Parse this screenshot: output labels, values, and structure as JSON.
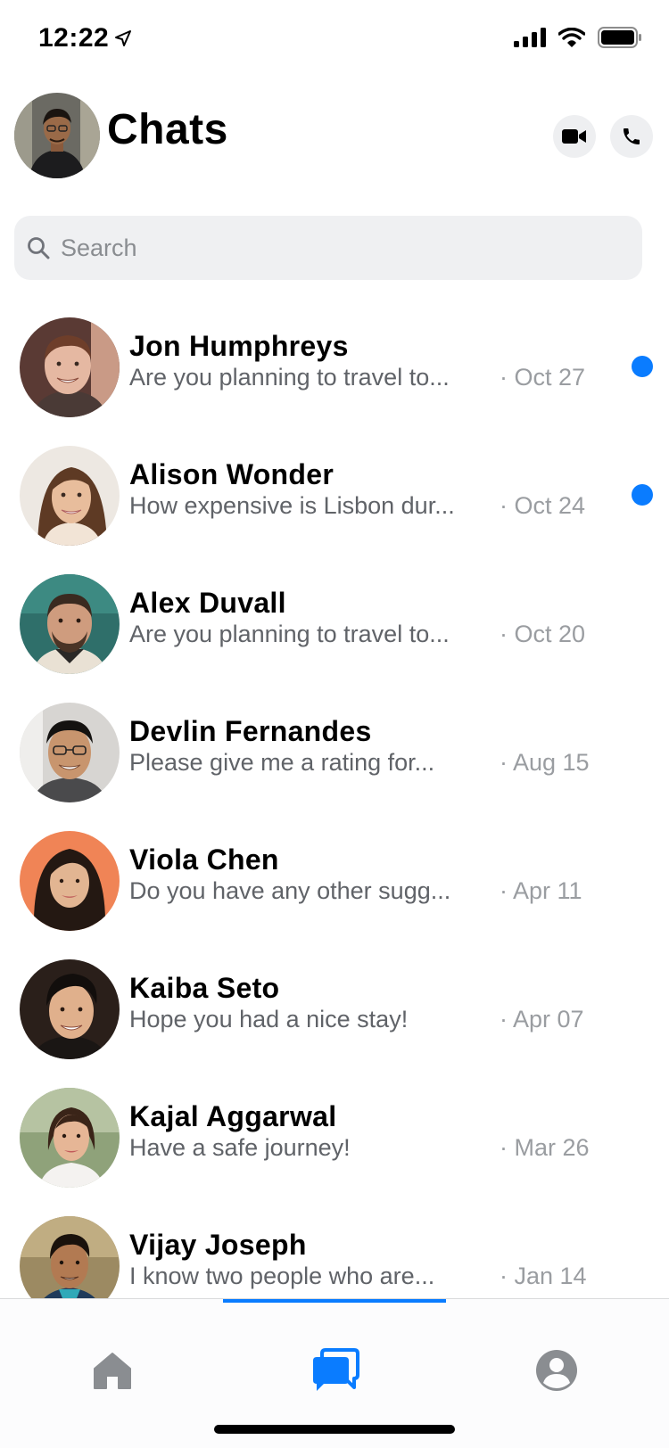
{
  "status_bar": {
    "time": "12:22",
    "icons": [
      "location-arrow-icon",
      "cellular-signal-icon",
      "wifi-icon",
      "battery-icon"
    ]
  },
  "header": {
    "title": "Chats",
    "actions": [
      "video-call-icon",
      "phone-icon"
    ]
  },
  "search": {
    "placeholder": "Search",
    "value": ""
  },
  "colors": {
    "accent": "#0a7cff",
    "search_bg": "#eff0f2",
    "preview_text": "#606368",
    "date_text": "#9a9da1"
  },
  "chats": [
    {
      "name": "Jon Humphreys",
      "preview": "Are you planning to travel to...",
      "date": "· Oct 27",
      "unread": true
    },
    {
      "name": "Alison Wonder",
      "preview": "How expensive is Lisbon dur...",
      "date": "· Oct 24",
      "unread": true
    },
    {
      "name": "Alex Duvall",
      "preview": "Are you planning to travel to...",
      "date": "· Oct 20",
      "unread": false
    },
    {
      "name": "Devlin Fernandes",
      "preview": "Please give me a rating for...",
      "date": "· Aug 15",
      "unread": false
    },
    {
      "name": "Viola Chen",
      "preview": "Do you have any other sugg...",
      "date": "· Apr 11",
      "unread": false
    },
    {
      "name": "Kaiba Seto",
      "preview": "Hope you had a nice stay!",
      "date": "· Apr 07",
      "unread": false
    },
    {
      "name": "Kajal Aggarwal",
      "preview": "Have a safe journey!",
      "date": "· Mar 26",
      "unread": false
    },
    {
      "name": "Vijay Joseph",
      "preview": "I know two people who are...",
      "date": "· Jan 14",
      "unread": false
    }
  ],
  "bottom_nav": {
    "items": [
      "home-icon",
      "chats-icon",
      "profile-icon"
    ],
    "active": "chats-icon"
  }
}
